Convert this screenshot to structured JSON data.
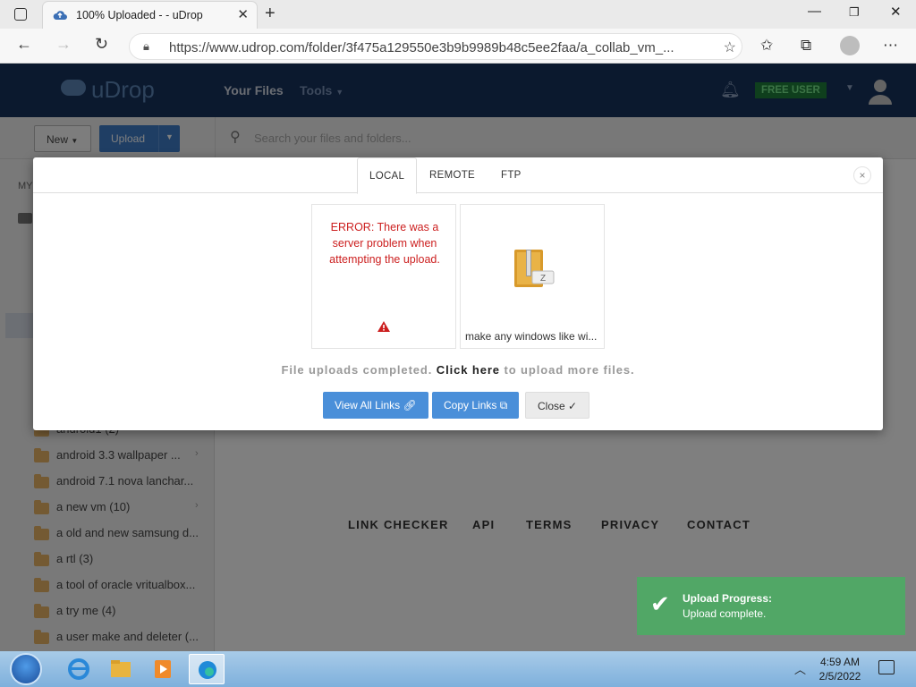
{
  "browser": {
    "tab_title": "100% Uploaded - - uDrop",
    "url": "https://www.udrop.com/folder/3f475a129550e3b9b9989b48c5ee2faa/a_collab_vm_..."
  },
  "site": {
    "logo": "uDrop",
    "nav": [
      "Your Files",
      "Tools"
    ],
    "badge": "FREE USER"
  },
  "toolbar": {
    "new_label": "New",
    "upload_label": "Upload",
    "search_placeholder": "Search your files and folders..."
  },
  "sidebar": {
    "header": "MY",
    "folders": [
      {
        "name": "android1 (2)",
        "caret": ""
      },
      {
        "name": "android 3.3 wallpaper ...",
        "caret": "›"
      },
      {
        "name": "android 7.1 nova lanchar...",
        "caret": ""
      },
      {
        "name": "a new vm (10)",
        "caret": "›"
      },
      {
        "name": "a old and new samsung d...",
        "caret": ""
      },
      {
        "name": "a rtl (3)",
        "caret": ""
      },
      {
        "name": "a tool of oracle vritualbox...",
        "caret": ""
      },
      {
        "name": "a try me (4)",
        "caret": ""
      },
      {
        "name": "a user make and deleter (...",
        "caret": ""
      }
    ]
  },
  "footer_links": [
    "LINK CHECKER",
    "API",
    "TERMS",
    "PRIVACY",
    "CONTACT"
  ],
  "modal": {
    "tabs": [
      "LOCAL",
      "REMOTE",
      "FTP"
    ],
    "close": "×",
    "error_text": "ERROR: There was a server problem when attempting the upload.",
    "file_name": "make any windows like wi...",
    "done_prefix": "File uploads completed. ",
    "done_link": "Click here",
    "done_suffix": " to upload more files.",
    "buttons": {
      "view_all": "View All Links",
      "copy": "Copy Links",
      "close": "Close"
    }
  },
  "toast": {
    "title": "Upload Progress:",
    "message": "Upload complete."
  },
  "taskbar": {
    "time": "4:59 AM",
    "date": "2/5/2022"
  },
  "colors": {
    "header_bg": "#16325c",
    "primary_button": "#4a8fd9",
    "toast_bg": "#51a766",
    "error_text": "#cc1f1f",
    "badge_bg": "#1e7f3a"
  }
}
